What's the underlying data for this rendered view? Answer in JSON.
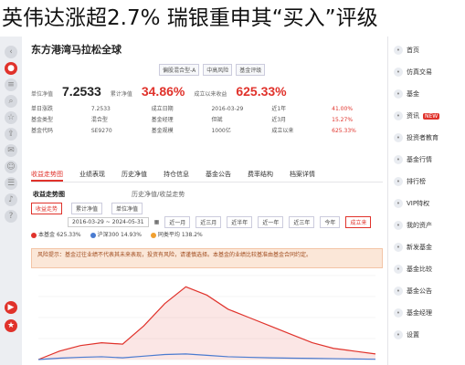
{
  "headline": "英伟达涨超2.7% 瑞银重申其“买入”评级",
  "stock": {
    "title": "东方港湾马拉松全球",
    "tags": [
      "偏股混合型-A",
      "中高风险",
      "基金评级"
    ],
    "nav_label": "单位净值",
    "nav": "7.2533",
    "cum_label": "累计净值",
    "cum": "34.86%",
    "return_label": "成立以来收益",
    "return": "625.33%"
  },
  "stats": [
    [
      "单日涨跌",
      "7.2533",
      "成立日期",
      "2016-03-29",
      "近1年",
      "41.00%"
    ],
    [
      "基金类型",
      "混合型",
      "基金经理",
      "但斌",
      "近3月",
      "15.27%"
    ],
    [
      "基金代码",
      "SE9270",
      "基金规模",
      "1000亿",
      "成立以来",
      "625.33%"
    ]
  ],
  "tabs": [
    "收益走势图",
    "业绩表现",
    "历史净值",
    "持仓信息",
    "基金公告",
    "费率结构",
    "档案详情"
  ],
  "section": {
    "title": "收益走势图",
    "subtitle": "历史净值/收益走势"
  },
  "filters": [
    "收益走势",
    "累计净值",
    "单位净值"
  ],
  "period": {
    "range": "2016-03-29 ~ 2024-05-31",
    "buttons": [
      "近一月",
      "近三月",
      "近半年",
      "近一年",
      "近三年",
      "今年",
      "成立来"
    ],
    "active_index": 6
  },
  "legend": [
    {
      "label": "本基金",
      "value": "625.33%",
      "color": "#e0322b"
    },
    {
      "label": "沪深300",
      "value": "14.93%",
      "color": "#4a7bd0"
    },
    {
      "label": "同类平均",
      "value": "138.2%",
      "color": "#f0a030"
    }
  ],
  "notice": "风险提示：基金过往业绩不代表其未来表现，投资有风险，请谨慎选择。本基金的业绩比较基准由基金合同约定。",
  "side_menu": [
    {
      "label": "首页",
      "icon": "home-icon"
    },
    {
      "label": "仿真交易",
      "icon": "trade-icon",
      "badge": ""
    },
    {
      "label": "基金",
      "icon": "fund-icon"
    },
    {
      "label": "资讯",
      "icon": "news-icon",
      "badge": "NEW"
    },
    {
      "label": "投资者教育",
      "icon": "book-icon"
    },
    {
      "label": "基金行情",
      "icon": "chart-icon"
    },
    {
      "label": "排行榜",
      "icon": "rank-icon"
    },
    {
      "label": "VIP特权",
      "icon": "vip-icon"
    },
    {
      "label": "我的资产",
      "icon": "wallet-icon"
    },
    {
      "label": "新发基金",
      "icon": "new-icon"
    },
    {
      "label": "基金比较",
      "icon": "compare-icon"
    },
    {
      "label": "基金公告",
      "icon": "notice-icon"
    },
    {
      "label": "基金经理",
      "icon": "manager-icon"
    },
    {
      "label": "设置",
      "icon": "gear-icon"
    }
  ],
  "chart_data": {
    "type": "area",
    "series": [
      {
        "name": "本基金",
        "values": [
          0,
          30,
          50,
          60,
          55,
          120,
          200,
          260,
          230,
          180,
          150,
          120,
          90,
          60,
          40,
          30,
          20
        ]
      },
      {
        "name": "沪深300",
        "values": [
          0,
          5,
          8,
          10,
          6,
          12,
          18,
          20,
          15,
          10,
          8,
          6,
          5,
          4,
          3,
          2,
          1
        ]
      }
    ],
    "ylim": [
      0,
      300
    ]
  }
}
